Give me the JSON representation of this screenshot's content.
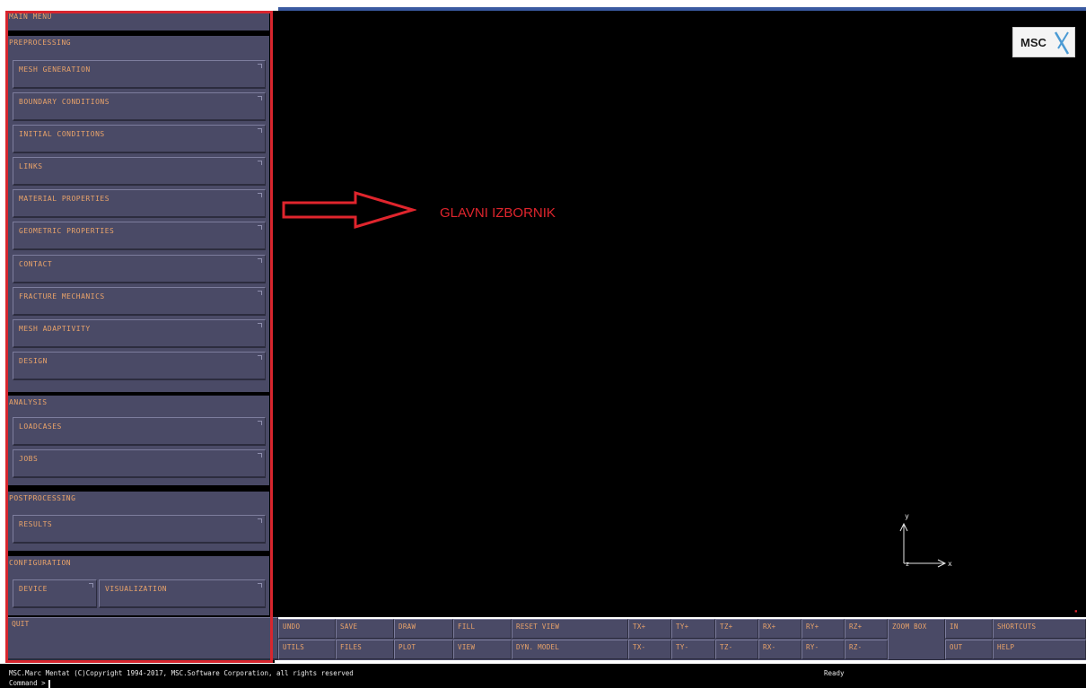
{
  "main_menu": {
    "title": "MAIN MENU",
    "preprocessing": {
      "title": "PREPROCESSING",
      "items": [
        "MESH GENERATION",
        "BOUNDARY CONDITIONS",
        "INITIAL CONDITIONS",
        "LINKS",
        "MATERIAL PROPERTIES",
        "GEOMETRIC PROPERTIES",
        "CONTACT",
        "FRACTURE MECHANICS",
        "MESH ADAPTIVITY",
        "DESIGN"
      ]
    },
    "analysis": {
      "title": "ANALYSIS",
      "items": [
        "LOADCASES",
        "JOBS"
      ]
    },
    "postprocessing": {
      "title": "POSTPROCESSING",
      "items": [
        "RESULTS"
      ]
    },
    "configuration": {
      "title": "CONFIGURATION",
      "items": [
        "DEVICE",
        "VISUALIZATION"
      ]
    },
    "quit": "QUIT"
  },
  "annotation": {
    "label": "GLAVNI IZBORNIK",
    "color": "#e0252d"
  },
  "logo": {
    "text": "MSC"
  },
  "axis": {
    "y": "y",
    "x": "x",
    "z": "z"
  },
  "toolbar": {
    "row1": [
      "UNDO",
      "SAVE",
      "DRAW",
      "FILL",
      "RESET VIEW",
      "TX+",
      "TY+",
      "TZ+",
      "RX+",
      "RY+",
      "RZ+",
      "ZOOM BOX",
      "IN",
      "SHORTCUTS"
    ],
    "row2": [
      "UTILS",
      "FILES",
      "PLOT",
      "VIEW",
      "DYN. MODEL",
      "TX-",
      "TY-",
      "TZ-",
      "RX-",
      "RY-",
      "RZ-",
      "OUT",
      "HELP"
    ]
  },
  "status": {
    "copyright": "MSC.Marc Mentat (C)Copyright 1994-2017, MSC.Software Corporation, all rights reserved",
    "state": "Ready",
    "prompt": "Command >"
  },
  "colors": {
    "panel": "#4a4a66",
    "text": "#e9a36a",
    "highlight": "#d8262e",
    "viewport": "#000000"
  }
}
